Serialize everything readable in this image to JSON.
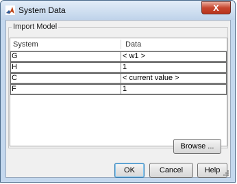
{
  "window": {
    "title": "System Data",
    "close_symbol": "X"
  },
  "group": {
    "label": "Import Model"
  },
  "table": {
    "columns": [
      "System",
      "Data"
    ],
    "rows": [
      {
        "system": "G",
        "data": "< w1 >"
      },
      {
        "system": "H",
        "data": "1"
      },
      {
        "system": "C",
        "data": "< current value >"
      },
      {
        "system": "F",
        "data": "1"
      }
    ]
  },
  "buttons": {
    "browse": "Browse ...",
    "ok": "OK",
    "cancel": "Cancel",
    "help": "Help"
  },
  "icons": {
    "app": "matlab-logo-icon",
    "close": "close-icon",
    "resize": "resize-grip-icon"
  }
}
